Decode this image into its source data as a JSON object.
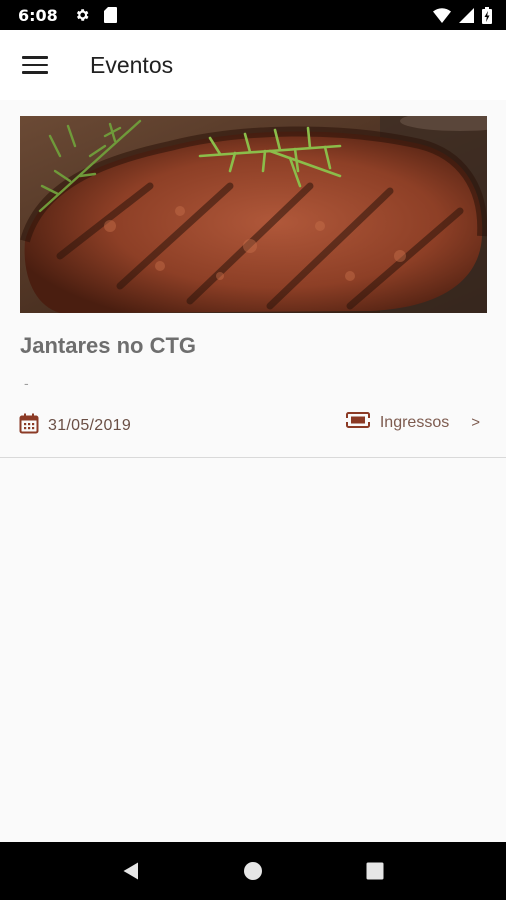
{
  "status_bar": {
    "time": "6:08",
    "left_icons": [
      "settings-icon",
      "sd-card-icon"
    ],
    "right_icons": [
      "wifi-icon",
      "cell-signal-icon",
      "battery-icon"
    ]
  },
  "app_bar": {
    "title": "Eventos",
    "menu_icon": "hamburger-menu-icon"
  },
  "events": [
    {
      "image": "grilled-steak-with-rosemary",
      "title": "Jantares no CTG",
      "description": "-",
      "date": "31/05/2019",
      "date_icon": "calendar-icon",
      "tickets_label": "Ingressos",
      "tickets_icon": "ticket-icon",
      "chevron": ">"
    }
  ],
  "nav_bar": {
    "buttons": [
      "back-icon",
      "home-icon",
      "recents-icon"
    ]
  },
  "colors": {
    "accent": "#8b3a25",
    "title_text": "#6e6e6e",
    "meta_text": "#6a4f45",
    "background": "#fafafa"
  }
}
